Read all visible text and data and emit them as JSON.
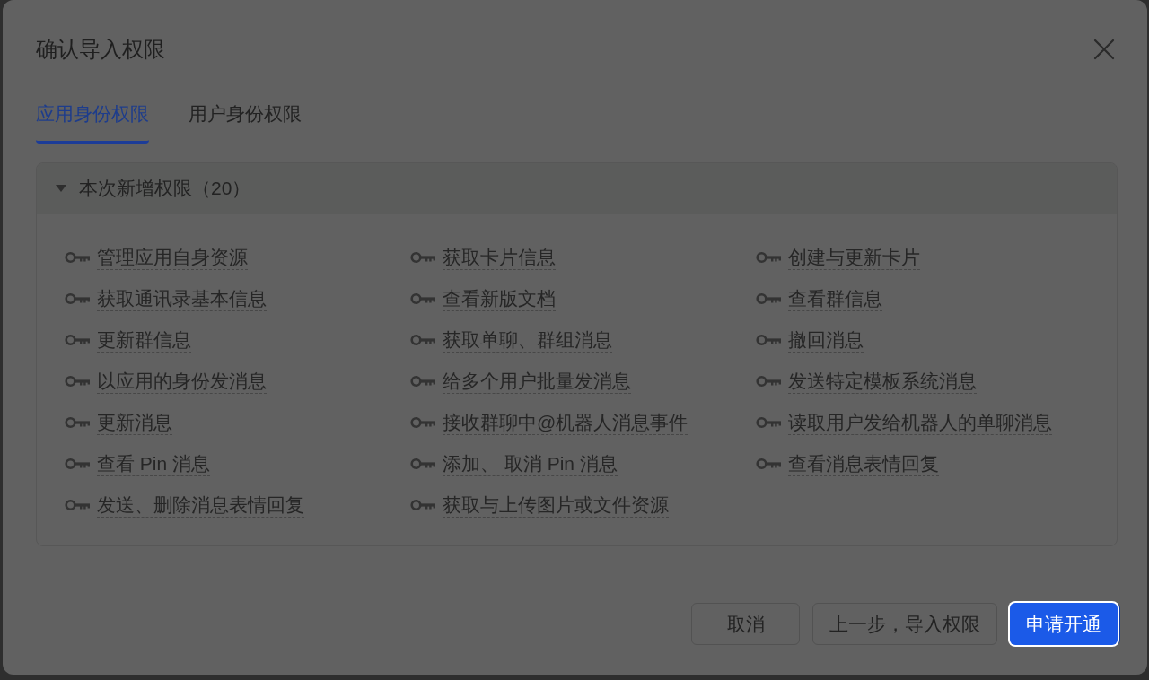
{
  "dialog": {
    "title": "确认导入权限"
  },
  "tabs": [
    {
      "label": "应用身份权限",
      "selected": true
    },
    {
      "label": "用户身份权限",
      "selected": false
    }
  ],
  "section": {
    "title": "本次新增权限（20）",
    "expanded": true,
    "permissions": [
      "管理应用自身资源",
      "获取卡片信息",
      "创建与更新卡片",
      "获取通讯录基本信息",
      "查看新版文档",
      "查看群信息",
      "更新群信息",
      "获取单聊、群组消息",
      "撤回消息",
      "以应用的身份发消息",
      "给多个用户批量发消息",
      "发送特定模板系统消息",
      "更新消息",
      "接收群聊中@机器人消息事件",
      "读取用户发给机器人的单聊消息",
      "查看 Pin 消息",
      "添加、 取消 Pin 消息",
      "查看消息表情回复",
      "发送、删除消息表情回复",
      "获取与上传图片或文件资源"
    ]
  },
  "buttons": [
    {
      "label": "取消",
      "kind": "default"
    },
    {
      "label": "上一步，导入权限",
      "kind": "default"
    },
    {
      "label": "申请开通",
      "kind": "primary"
    }
  ]
}
